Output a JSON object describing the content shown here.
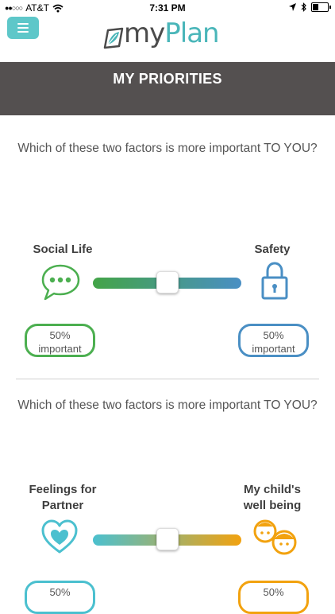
{
  "status_bar": {
    "carrier": "AT&T",
    "time": "7:31 PM"
  },
  "header": {
    "logo_my": "my",
    "logo_plan": "Plan"
  },
  "page": {
    "title": "MY PRIORITIES"
  },
  "comparisons": [
    {
      "question": "Which of these two factors is more important TO YOU?",
      "left": {
        "label": "Social Life",
        "percent": "50%",
        "suffix": "important",
        "color": "#4caf50"
      },
      "right": {
        "label": "Safety",
        "percent": "50%",
        "suffix": "important",
        "color": "#4a8fc4"
      },
      "slider_value": 0.5
    },
    {
      "question": "Which of these two factors is more important TO YOU?",
      "left": {
        "label": "Feelings for Partner",
        "percent": "50%",
        "suffix": "",
        "color": "#4bc0cf"
      },
      "right": {
        "label": "My child's well being",
        "percent": "50%",
        "suffix": "",
        "color": "#f2a20f"
      },
      "slider_value": 0.5
    }
  ],
  "colors": {
    "accent": "#5ec7c9",
    "title_bar": "#545050",
    "social": "#4caf50",
    "safety": "#4a8fc4",
    "partner": "#4bc0cf",
    "child": "#f2a20f"
  }
}
